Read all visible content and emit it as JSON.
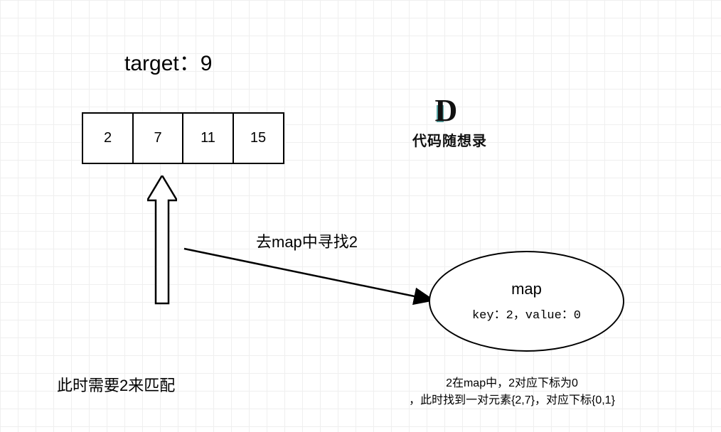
{
  "target_label": "target：9",
  "array": {
    "c0": "2",
    "c1": "7",
    "c2": "11",
    "c3": "15"
  },
  "pointer_index": 1,
  "need_label": "此时需要2来匹配",
  "arrow_label": "去map中寻找2",
  "map": {
    "title": "map",
    "content": "key：2，value：0"
  },
  "map_note_line1": "2在map中，2对应下标为0",
  "map_note_line2": "，此时找到一对元素{2,7}，对应下标{0,1}",
  "watermark": "代码随想录"
}
